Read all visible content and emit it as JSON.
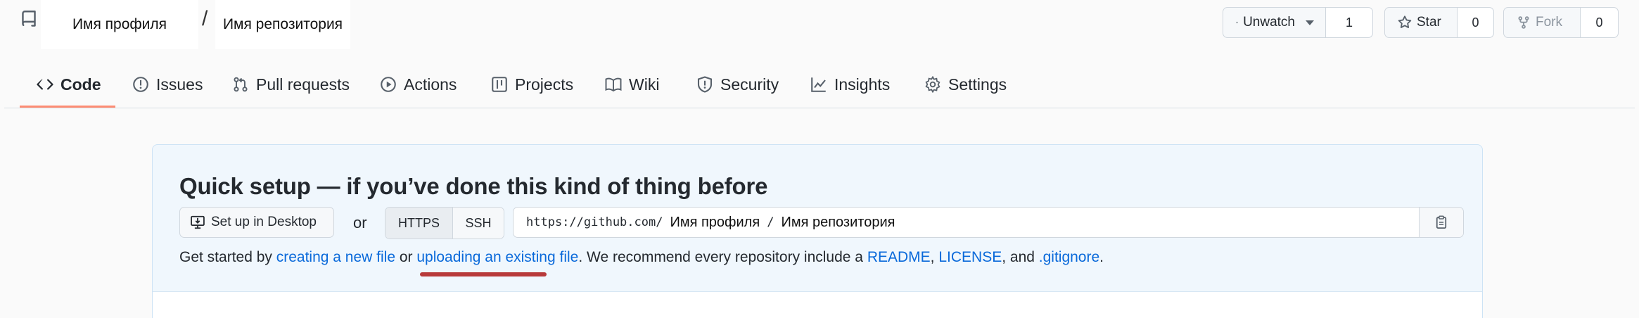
{
  "header": {
    "owner": "Имя профиля",
    "separator": "/",
    "repo": "Имя репозитория",
    "watch": {
      "label": "Unwatch",
      "count": "1"
    },
    "star": {
      "label": "Star",
      "count": "0"
    },
    "fork": {
      "label": "Fork",
      "count": "0"
    }
  },
  "tabs": [
    {
      "label": "Code",
      "icon": "code-icon",
      "active": true
    },
    {
      "label": "Issues",
      "icon": "issue-icon"
    },
    {
      "label": "Pull requests",
      "icon": "pull-request-icon"
    },
    {
      "label": "Actions",
      "icon": "play-icon"
    },
    {
      "label": "Projects",
      "icon": "table-icon"
    },
    {
      "label": "Wiki",
      "icon": "book-icon"
    },
    {
      "label": "Security",
      "icon": "shield-icon"
    },
    {
      "label": "Insights",
      "icon": "graph-icon"
    },
    {
      "label": "Settings",
      "icon": "gear-icon"
    }
  ],
  "quick_setup": {
    "title": "Quick setup — if you’ve done this kind of thing before",
    "desktop_button": "Set up in Desktop",
    "or": "or",
    "protocols": [
      "HTTPS",
      "SSH"
    ],
    "selected_protocol": "HTTPS",
    "url_prefix": "https://github.com/",
    "url_owner": "Имя профиля",
    "url_slash": "/",
    "url_repo": "Имя репозитория",
    "help": {
      "t1": "Get started by ",
      "link_new_file": "creating a new file",
      "t2": " or ",
      "link_upload": "uploading an existing file",
      "t3": ". We recommend every repository include a ",
      "link_readme": "README",
      "t4": ", ",
      "link_license": "LICENSE",
      "t5": ", and ",
      "link_gitignore": ".gitignore",
      "t6": "."
    }
  },
  "colors": {
    "link": "#0969da",
    "active_tab_underline": "#fd8c73",
    "annotation_underline": "#b83a3a",
    "panel_background": "#f0f7fd"
  }
}
